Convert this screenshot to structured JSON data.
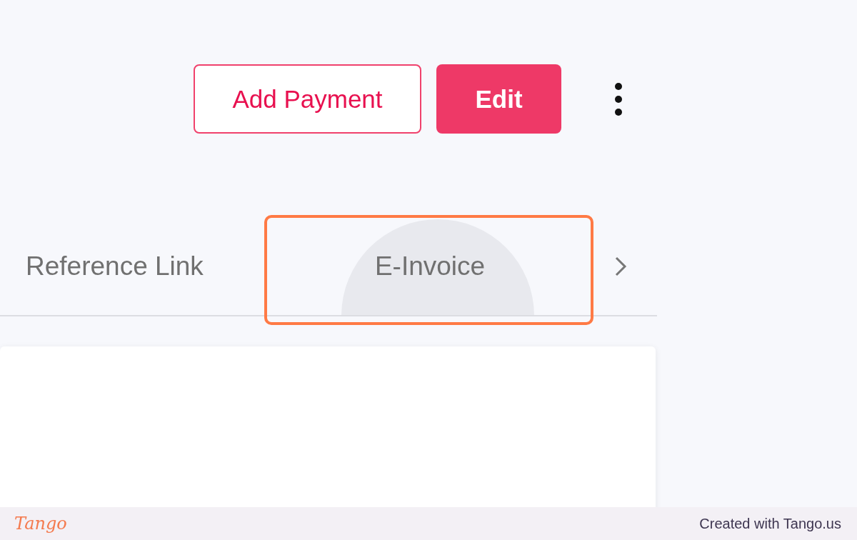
{
  "header": {
    "buttons": [
      {
        "label": "Add Payment",
        "kind": "outline"
      },
      {
        "label": "Edit",
        "kind": "filled"
      }
    ]
  },
  "tabs": [
    {
      "label": "Reference Link",
      "ripple": false
    },
    {
      "label": "E-Invoice",
      "ripple": true
    }
  ],
  "footer": {
    "logo": "Tango",
    "credit": "Created with Tango.us"
  }
}
